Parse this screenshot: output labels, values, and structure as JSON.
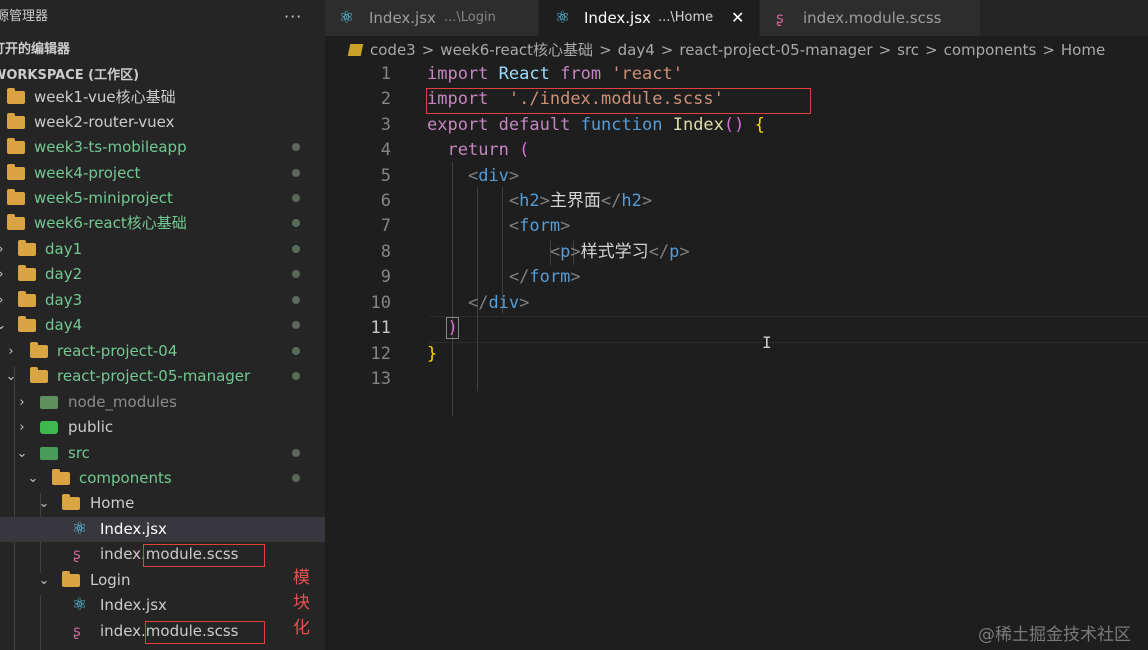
{
  "sidebar": {
    "title": "源管理器",
    "more": "···",
    "open_editors": "打开的编辑器",
    "workspace": "WORKSPACE (工作区)",
    "tree": [
      {
        "label": "week1-vue核心基础"
      },
      {
        "label": "week2-router-vuex"
      },
      {
        "label": "week3-ts-mobileapp"
      },
      {
        "label": "week4-project"
      },
      {
        "label": "week5-miniproject"
      },
      {
        "label": "week6-react核心基础"
      },
      {
        "label": "day1"
      },
      {
        "label": "day2"
      },
      {
        "label": "day3"
      },
      {
        "label": "day4"
      },
      {
        "label": "react-project-04"
      },
      {
        "label": "react-project-05-manager"
      },
      {
        "label": "node_modules"
      },
      {
        "label": "public"
      },
      {
        "label": "src"
      },
      {
        "label": "components"
      },
      {
        "label": "Home"
      },
      {
        "label": "Index.jsx"
      },
      {
        "label": "index.module.scss"
      },
      {
        "label": "Login"
      },
      {
        "label": "Index.jsx"
      },
      {
        "label": "index.module.scss"
      }
    ],
    "annotation": "模块化"
  },
  "tabs": [
    {
      "name": "Index.jsx",
      "desc": "...\\Login"
    },
    {
      "name": "Index.jsx",
      "desc": "...\\Home",
      "close": "✕"
    },
    {
      "name": "index.module.scss"
    }
  ],
  "breadcrumb": [
    "code3",
    "week6-react核心基础",
    "day4",
    "react-project-05-manager",
    "src",
    "components",
    "Home"
  ],
  "editor": {
    "line_numbers": [
      "1",
      "2",
      "3",
      "4",
      "5",
      "6",
      "7",
      "8",
      "9",
      "10",
      "11",
      "12",
      "13"
    ],
    "code": {
      "l1_import": "import",
      "l1_react": "React",
      "l1_from": "from",
      "l1_str": "'react'",
      "l2_import": "import",
      "l2_str": "'./index.module.scss'",
      "l3_export": "export",
      "l3_default": "default",
      "l3_function": "function",
      "l3_name": "Index",
      "l3_paren": "()",
      "l3_brace": "{",
      "l4_return": "return",
      "l4_paren": "(",
      "l5_open": "<",
      "l5_tag": "div",
      "l5_close": ">",
      "l6_open": "<",
      "l6_tag": "h2",
      "l6_gt": ">",
      "l6_text": "主界面",
      "l6_endopen": "</",
      "l6_endtag": "h2",
      "l6_endgt": ">",
      "l7_open": "<",
      "l7_tag": "form",
      "l7_close": ">",
      "l8_open": "<",
      "l8_tag": "p",
      "l8_gt": ">",
      "l8_text": "样式学习",
      "l8_endopen": "</",
      "l8_endtag": "p",
      "l8_endgt": ">",
      "l9_open": "</",
      "l9_tag": "form",
      "l9_close": ">",
      "l10_open": "</",
      "l10_tag": "div",
      "l10_close": ">",
      "l11_paren": ")",
      "l12_brace": "}"
    }
  },
  "watermark": "@稀土掘金技术社区"
}
